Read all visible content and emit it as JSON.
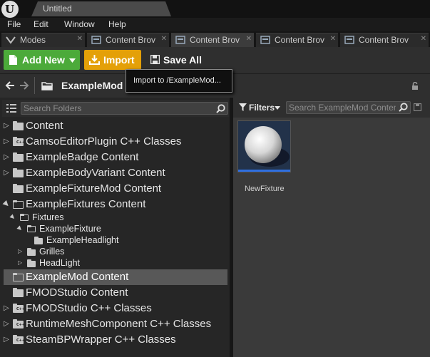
{
  "window": {
    "title": "Untitled",
    "logo_letter": "U"
  },
  "menu": [
    "File",
    "Edit",
    "Window",
    "Help"
  ],
  "tabs": [
    {
      "label": "Modes",
      "icon": "modes-icon",
      "active": false
    },
    {
      "label": "Content Brov",
      "icon": "content-browser-icon",
      "active": false
    },
    {
      "label": "Content Brov",
      "icon": "content-browser-icon",
      "active": true
    },
    {
      "label": "Content Brov",
      "icon": "content-browser-icon",
      "active": false
    },
    {
      "label": "Content Brov",
      "icon": "content-browser-icon",
      "active": false
    }
  ],
  "toolbar": {
    "add_new_label": "Add New",
    "import_label": "Import",
    "save_all_label": "Save All"
  },
  "tooltip": {
    "text": "Import to /ExampleMod..."
  },
  "path": {
    "current": "ExampleMod"
  },
  "folder_search": {
    "placeholder": "Search Folders"
  },
  "tree": [
    {
      "label": "Content",
      "kind": "folder",
      "expandable": true
    },
    {
      "label": "CamsoEditorPlugin C++ Classes",
      "kind": "cpp",
      "expandable": true
    },
    {
      "label": "ExampleBadge Content",
      "kind": "folder",
      "expandable": true
    },
    {
      "label": "ExampleBodyVariant Content",
      "kind": "folder",
      "expandable": true
    },
    {
      "label": "ExampleFixtureMod Content",
      "kind": "folder",
      "expandable": false
    },
    {
      "label": "ExampleFixtures Content",
      "kind": "open",
      "expandable": true,
      "expanded": true
    },
    {
      "label": "Fixtures",
      "kind": "open",
      "expandable": true,
      "expanded": true
    },
    {
      "label": "ExampleFixture",
      "kind": "open",
      "expandable": true,
      "expanded": true
    },
    {
      "label": "ExampleHeadlight",
      "kind": "folder",
      "expandable": false
    },
    {
      "label": "Grilles",
      "kind": "folder",
      "expandable": true
    },
    {
      "label": "HeadLight",
      "kind": "folder",
      "expandable": true
    },
    {
      "label": "ExampleMod Content",
      "kind": "open",
      "expandable": false,
      "selected": true
    },
    {
      "label": "FMODStudio Content",
      "kind": "folder",
      "expandable": false
    },
    {
      "label": "FMODStudio C++ Classes",
      "kind": "cpp",
      "expandable": true
    },
    {
      "label": "RuntimeMeshComponent C++ Classes",
      "kind": "cpp",
      "expandable": true
    },
    {
      "label": "SteamBPWrapper C++ Classes",
      "kind": "cpp",
      "expandable": true
    }
  ],
  "assets": {
    "filters_label": "Filters",
    "search_placeholder": "Search ExampleMod Conten",
    "items": [
      {
        "name": "NewFixture",
        "thumbnail": "sphere-thumbnail"
      }
    ]
  },
  "colors": {
    "add_new": "#4caa3a",
    "import": "#e4a008",
    "selection": "#585858",
    "asset_bar": "#2f6fe0"
  }
}
